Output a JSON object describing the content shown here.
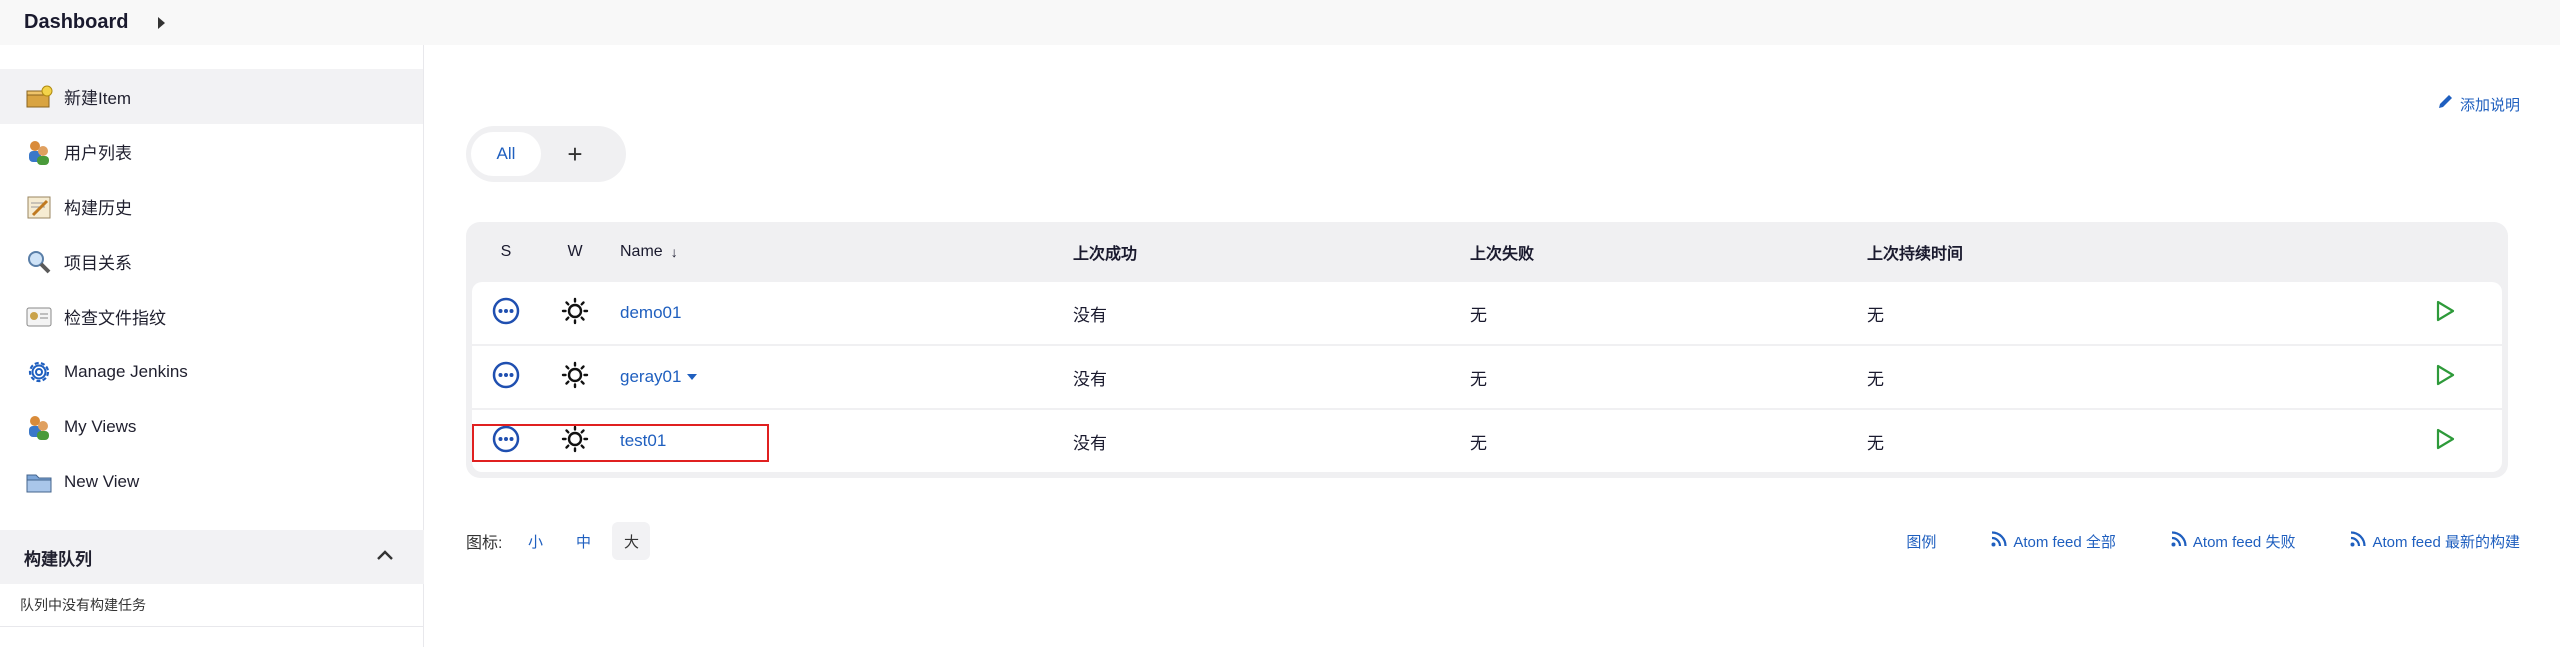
{
  "breadcrumb": {
    "root": "Dashboard"
  },
  "sidebar": {
    "tasks": [
      {
        "label": "新建Item",
        "icon": "new-item-icon"
      },
      {
        "label": "用户列表",
        "icon": "users-icon"
      },
      {
        "label": "构建历史",
        "icon": "build-history-icon"
      },
      {
        "label": "项目关系",
        "icon": "search-icon"
      },
      {
        "label": "检查文件指纹",
        "icon": "fingerprint-icon"
      },
      {
        "label": "Manage Jenkins",
        "icon": "gear-icon"
      },
      {
        "label": "My Views",
        "icon": "users-icon"
      },
      {
        "label": "New View",
        "icon": "folder-icon"
      }
    ],
    "build_queue": {
      "title": "构建队列",
      "empty_text": "队列中没有构建任务"
    }
  },
  "main": {
    "add_description": "添加说明",
    "tabs": {
      "all": "All",
      "add": "+"
    },
    "table": {
      "headers": {
        "s": "S",
        "w": "W",
        "name": "Name",
        "sort": "↓",
        "last_success": "上次成功",
        "last_failure": "上次失败",
        "last_duration": "上次持续时间"
      },
      "rows": [
        {
          "name": "demo01",
          "last_success": "没有",
          "last_failure": "无",
          "last_duration": "无",
          "has_menu": false
        },
        {
          "name": "geray01",
          "last_success": "没有",
          "last_failure": "无",
          "last_duration": "无",
          "has_menu": true
        },
        {
          "name": "test01",
          "last_success": "没有",
          "last_failure": "无",
          "last_duration": "无",
          "has_menu": false
        }
      ]
    },
    "icon_size": {
      "label": "图标:",
      "small": "小",
      "medium": "中",
      "large": "大",
      "selected": "大"
    },
    "footer_links": {
      "legend": "图例",
      "atom_all": "Atom feed 全部",
      "atom_failed": "Atom feed 失败",
      "atom_latest": "Atom feed 最新的构建"
    }
  },
  "colors": {
    "link": "#1f5fbf",
    "status_blue": "#1f4fb0",
    "build_green": "#2e9a3a",
    "highlight": "#e02020"
  }
}
